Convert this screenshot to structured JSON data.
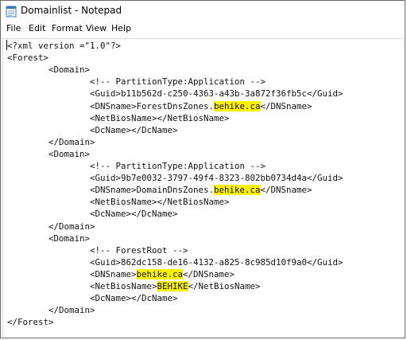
{
  "window": {
    "title": "Domainlist - Notepad",
    "icon": "notepad-icon"
  },
  "menu": [
    "File",
    "Edit",
    "Format",
    "View",
    "Help"
  ],
  "editor_lines": [
    [
      {
        "t": "<?xml version =\"1.0\"?>"
      }
    ],
    [
      {
        "t": "<Forest>"
      }
    ],
    [
      {
        "t": "        <Domain>"
      }
    ],
    [
      {
        "t": "                <!-- PartitionType:Application -->"
      }
    ],
    [
      {
        "t": "                <Guid>b11b562d-c250-4363-a43b-3a872f36fb5c</Guid>"
      }
    ],
    [
      {
        "t": "                <DNSname>ForestDnsZones."
      },
      {
        "t": "behike.ca",
        "hl": true
      },
      {
        "t": "</DNSname>"
      }
    ],
    [
      {
        "t": "                <NetBiosName></NetBiosName>"
      }
    ],
    [
      {
        "t": "                <DcName></DcName>"
      }
    ],
    [
      {
        "t": "        </Domain>"
      }
    ],
    [
      {
        "t": "        <Domain>"
      }
    ],
    [
      {
        "t": "                <!-- PartitionType:Application -->"
      }
    ],
    [
      {
        "t": "                <Guid>9b7e0032-3797-49f4-8323-802bb0734d4a</Guid>"
      }
    ],
    [
      {
        "t": "                <DNSname>DomainDnsZones."
      },
      {
        "t": "behike.ca",
        "hl": true
      },
      {
        "t": "</DNSname>"
      }
    ],
    [
      {
        "t": "                <NetBiosName></NetBiosName>"
      }
    ],
    [
      {
        "t": "                <DcName></DcName>"
      }
    ],
    [
      {
        "t": "        </Domain>"
      }
    ],
    [
      {
        "t": "        <Domain>"
      }
    ],
    [
      {
        "t": "                <!-- ForestRoot -->"
      }
    ],
    [
      {
        "t": "                <Guid>862dc158-de16-4132-a825-8c985d10f9a0</Guid>"
      }
    ],
    [
      {
        "t": "                <DNSname>"
      },
      {
        "t": "behike.ca",
        "hl": true
      },
      {
        "t": "</DNSname>"
      }
    ],
    [
      {
        "t": "                <NetBiosName>"
      },
      {
        "t": "BEHIKE",
        "hl": true
      },
      {
        "t": "</NetBiosName>"
      }
    ],
    [
      {
        "t": "                <DcName></DcName>"
      }
    ],
    [
      {
        "t": "        </Domain>"
      }
    ],
    [
      {
        "t": "</Forest>"
      }
    ]
  ],
  "colors": {
    "highlight": "#fff200",
    "text": "#111111",
    "window_border": "#6b6b6b"
  }
}
